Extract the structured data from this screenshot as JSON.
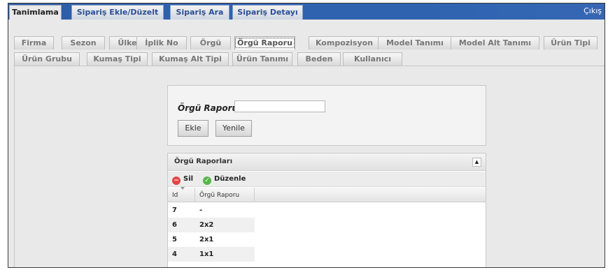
{
  "top_tabs": [
    {
      "label": "Tanimlama",
      "active": true
    },
    {
      "label": "Sipariş Ekle/Düzelt",
      "active": false
    },
    {
      "label": "Sipariş Ara",
      "active": false
    },
    {
      "label": "Sipariş Detayı",
      "active": false
    }
  ],
  "logout_label": "Çıkış",
  "sub_tabs_row1": [
    {
      "label": "Firma"
    },
    {
      "label": "Sezon"
    },
    {
      "label": "Ülke"
    },
    {
      "label": "İplik No"
    },
    {
      "label": "Örgü"
    },
    {
      "label": "Örgü Raporu",
      "active": true
    },
    {
      "label": "Kompozisyon"
    },
    {
      "label": "Model Tanımı"
    },
    {
      "label": "Model Alt Tanımı"
    },
    {
      "label": "Ürün Tipi"
    }
  ],
  "sub_tabs_row2": [
    {
      "label": "Ürün Grubu"
    },
    {
      "label": "Kumaş Tipi"
    },
    {
      "label": "Kumaş Alt Tipi"
    },
    {
      "label": "Ürün Tanımı"
    },
    {
      "label": "Beden"
    },
    {
      "label": "Kullanıcı"
    }
  ],
  "form": {
    "label": "Örgü Raporu:",
    "input_value": "",
    "add_button": "Ekle",
    "refresh_button": "Yenile"
  },
  "grid": {
    "caption": "Örgü Raporları",
    "delete_label": "Sil",
    "edit_label": "Düzenle",
    "columns": [
      "Id",
      "Örgü Raporu"
    ],
    "rows": [
      {
        "id": "7",
        "value": "-"
      },
      {
        "id": "6",
        "value": "2x2"
      },
      {
        "id": "5",
        "value": "2x1"
      },
      {
        "id": "4",
        "value": "1x1"
      }
    ]
  },
  "colors": {
    "topbar": "#2f63b0",
    "delete_icon": "#e04646",
    "edit_icon": "#56b64a"
  }
}
